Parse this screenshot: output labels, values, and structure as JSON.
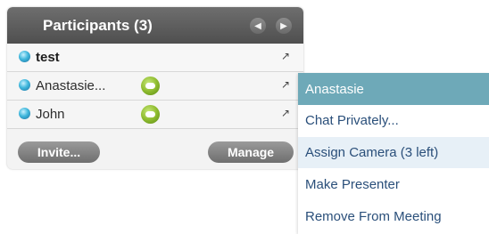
{
  "panel": {
    "title": "Participants (3)",
    "participants": [
      {
        "name": "test",
        "bold": true,
        "pin": "↗"
      },
      {
        "name": "Anastasie...",
        "bold": false,
        "pin": "↗"
      },
      {
        "name": "John",
        "bold": false,
        "pin": "↗"
      }
    ],
    "invite_label": "Invite...",
    "manage_label": "Manage"
  },
  "menu": {
    "header": "Anastasie",
    "items": [
      "Chat Privately...",
      "Assign Camera (3 left)",
      "Make Presenter",
      "Remove From Meeting"
    ]
  },
  "colors": {
    "accent": "#6ea9b8",
    "menu_text": "#2a4f7a",
    "status_blue": "#3fb7dc",
    "chat_green": "#8fbc2f"
  },
  "icons": {
    "prev": "chevron-left-icon",
    "next": "chevron-right-icon",
    "status": "status-dot-icon",
    "chat": "chat-bubble-icon",
    "pin": "pin-icon"
  }
}
